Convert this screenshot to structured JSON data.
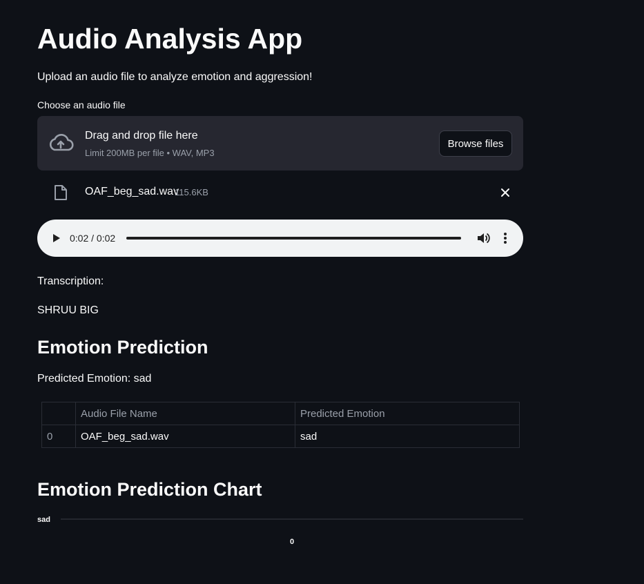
{
  "app": {
    "title": "Audio Analysis App",
    "subtitle": "Upload an audio file to analyze emotion and aggression!"
  },
  "uploader": {
    "label": "Choose an audio file",
    "dropzone_title": "Drag and drop file here",
    "dropzone_limit": "Limit 200MB per file • WAV, MP3",
    "browse_label": "Browse files",
    "icon": "cloud-upload-icon"
  },
  "uploaded_file": {
    "name": "OAF_beg_sad.wav",
    "size": "115.6KB",
    "icon": "file-icon",
    "remove_icon": "close-icon"
  },
  "audio_player": {
    "time": "0:02 / 0:02",
    "progress": 1.0,
    "icons": [
      "play-icon",
      "volume-icon",
      "more-vert-icon"
    ]
  },
  "transcription": {
    "label": "Transcription:",
    "text": "SHRUU BIG"
  },
  "emotion": {
    "heading": "Emotion Prediction",
    "predicted_text": "Predicted Emotion: sad"
  },
  "results_table": {
    "columns": [
      "",
      "Audio File Name",
      "Predicted Emotion"
    ],
    "rows": [
      {
        "index": "0",
        "file_name": "OAF_beg_sad.wav",
        "emotion": "sad"
      }
    ]
  },
  "chart_section": {
    "heading": "Emotion Prediction Chart"
  },
  "chart_data": {
    "type": "bar",
    "orientation": "horizontal",
    "categories": [
      "sad"
    ],
    "values": [
      0
    ],
    "x_ticks": [
      "0"
    ],
    "title": "",
    "xlabel": "",
    "ylabel": "",
    "colors": {
      "axis": "#3a3d45",
      "text": "#fafafa"
    }
  },
  "colors": {
    "background": "#0e1117",
    "panel": "#262730",
    "text": "#fafafa",
    "muted": "#9aa0aa",
    "player_bg": "#f1f3f4"
  }
}
